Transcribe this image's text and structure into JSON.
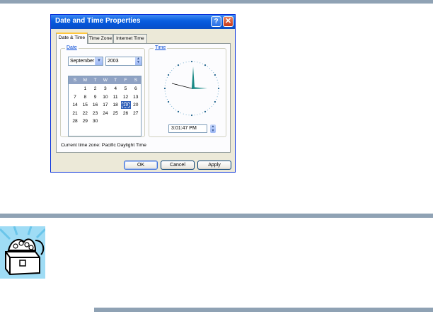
{
  "dialog": {
    "title": "Date and Time Properties",
    "help_button": "?",
    "close_button": "✕"
  },
  "tabs": [
    {
      "label": "Date & Time",
      "active": true
    },
    {
      "label": "Time Zone",
      "active": false
    },
    {
      "label": "Internet Time",
      "active": false
    }
  ],
  "date_group": {
    "label": "Date",
    "month": "September",
    "year": "2003",
    "weekdays": [
      "S",
      "M",
      "T",
      "W",
      "T",
      "F",
      "S"
    ],
    "weeks": [
      [
        "",
        "1",
        "2",
        "3",
        "4",
        "5",
        "6"
      ],
      [
        "7",
        "8",
        "9",
        "10",
        "11",
        "12",
        "13"
      ],
      [
        "14",
        "15",
        "16",
        "17",
        "18",
        "19",
        "20"
      ],
      [
        "21",
        "22",
        "23",
        "24",
        "25",
        "26",
        "27"
      ],
      [
        "28",
        "29",
        "30",
        "",
        "",
        "",
        ""
      ]
    ],
    "selected_day": "19"
  },
  "time_group": {
    "label": "Time",
    "time_value": "3:01:47 PM"
  },
  "timezone_text": "Current time zone:  Pacific Daylight Time",
  "buttons": {
    "ok": "OK",
    "cancel": "Cancel",
    "apply": "Apply"
  },
  "colors": {
    "titlebar": "#0a5fe0",
    "rule": "#8fa2b4",
    "selection": "#2f5fb8",
    "clock_hands": "#1a8a86"
  },
  "icons": {
    "note_icon": "treasure-chest-icon"
  }
}
